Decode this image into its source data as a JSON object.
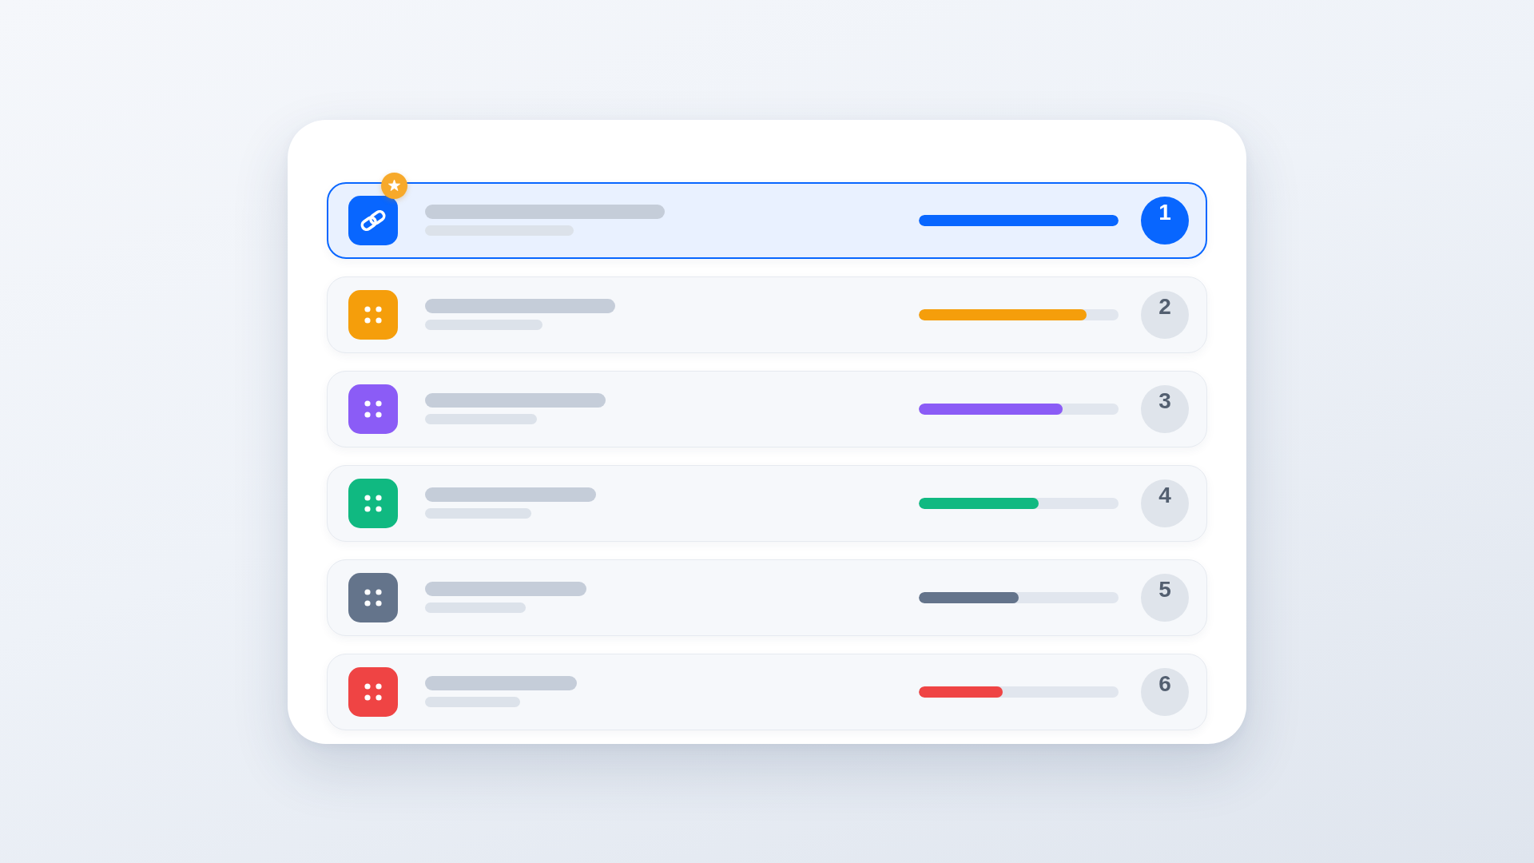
{
  "list": {
    "items": [
      {
        "kind": "link",
        "selected": true,
        "starred": true,
        "color": "#0866ff",
        "level": 1,
        "rank": "1"
      },
      {
        "kind": "grid",
        "selected": false,
        "starred": false,
        "color": "#f59e0b",
        "level": 0.84,
        "rank": "2"
      },
      {
        "kind": "grid",
        "selected": false,
        "starred": false,
        "color": "#8b5cf6",
        "level": 0.72,
        "rank": "3"
      },
      {
        "kind": "grid",
        "selected": false,
        "starred": false,
        "color": "#10b981",
        "level": 0.6,
        "rank": "4"
      },
      {
        "kind": "grid",
        "selected": false,
        "starred": false,
        "color": "#64748b",
        "level": 0.5,
        "rank": "5"
      },
      {
        "kind": "grid",
        "selected": false,
        "starred": false,
        "color": "#ef4444",
        "level": 0.42,
        "rank": "6"
      }
    ]
  }
}
